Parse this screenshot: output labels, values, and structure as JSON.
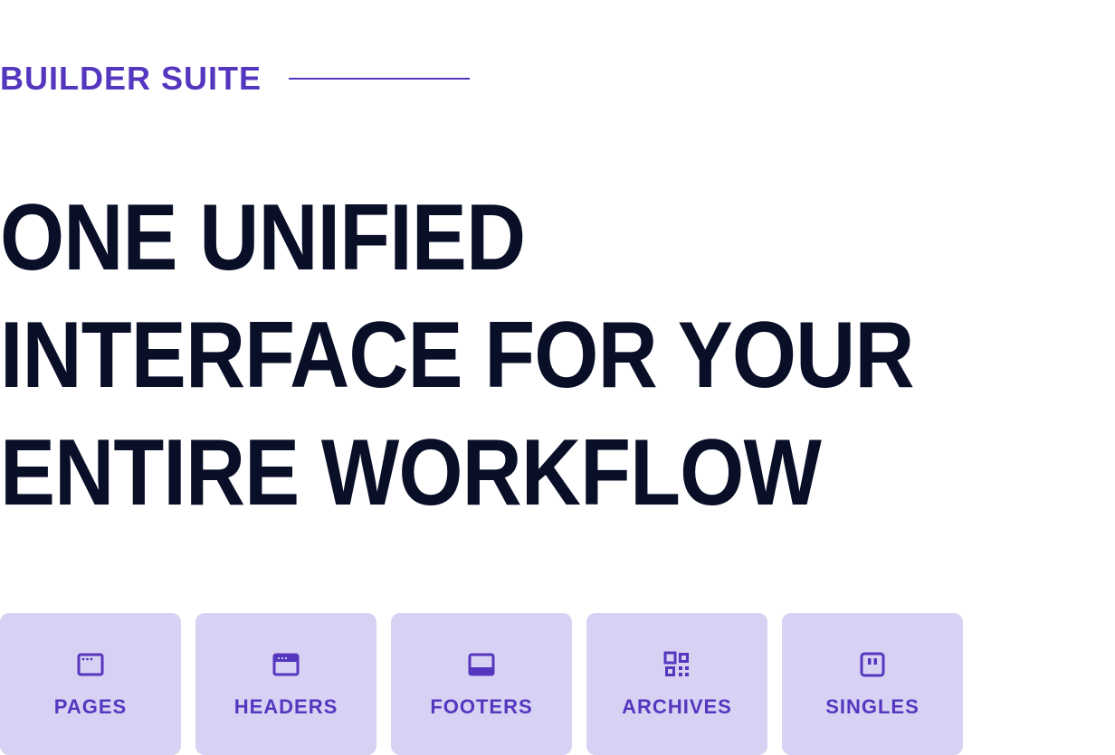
{
  "eyebrow": "BUILDER SUITE",
  "heading": "ONE UNIFIED INTERFACE FOR YOUR ENTIRE WORKFLOW",
  "cards": [
    {
      "label": "PAGES",
      "icon": "window-icon"
    },
    {
      "label": "HEADERS",
      "icon": "header-icon"
    },
    {
      "label": "FOOTERS",
      "icon": "footer-icon"
    },
    {
      "label": "ARCHIVES",
      "icon": "qr-icon"
    },
    {
      "label": "SINGLES",
      "icon": "pause-box-icon"
    }
  ],
  "colors": {
    "accent": "#5536BF",
    "card_bg": "#D7D2F3",
    "heading": "#0A0F28"
  }
}
